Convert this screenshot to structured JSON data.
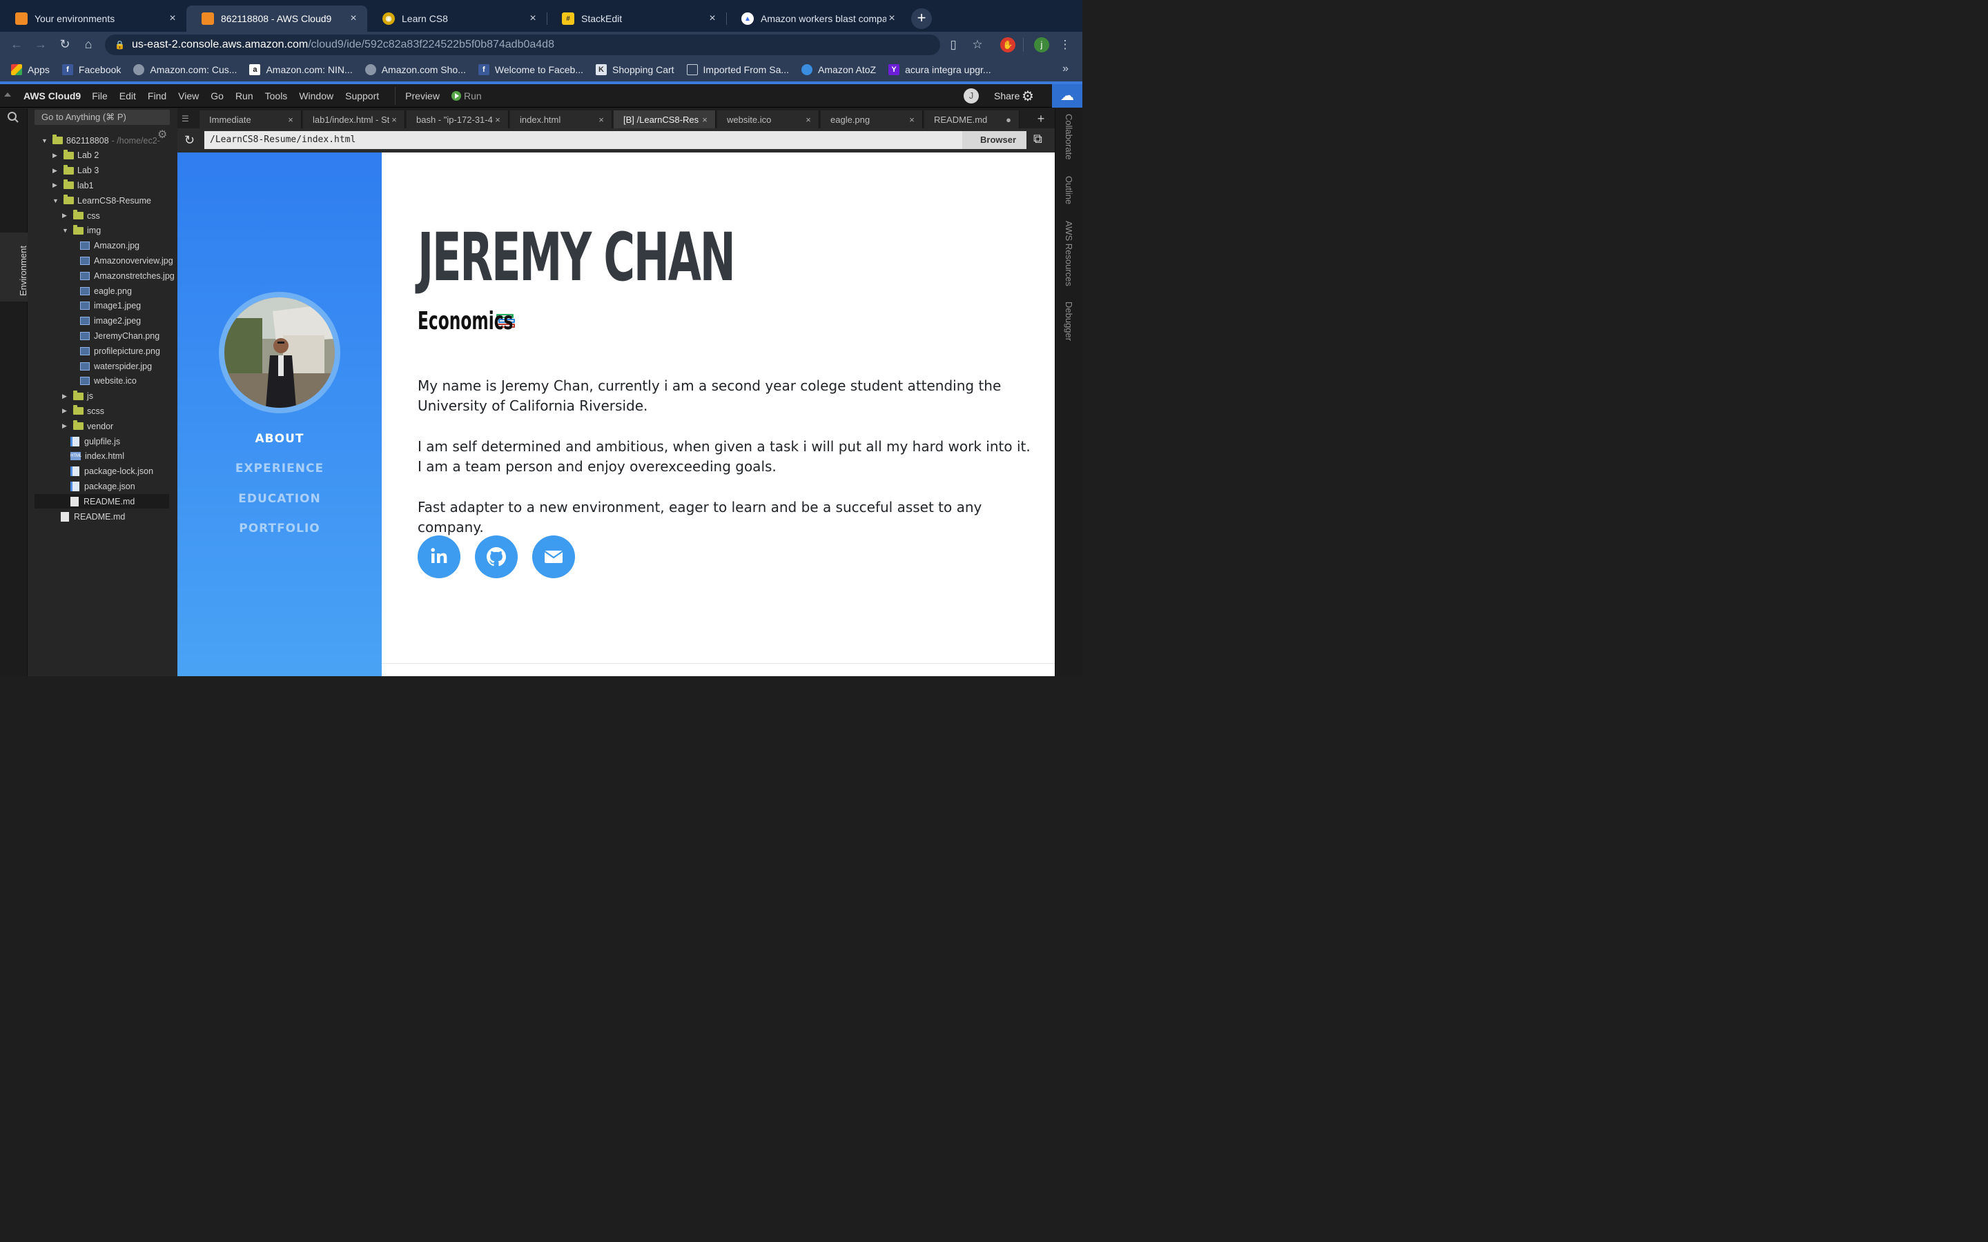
{
  "browser": {
    "tabs": [
      {
        "title": "Your environments",
        "icon": "aws-box-icon",
        "color": "#f08a24",
        "active": false
      },
      {
        "title": "862118808 - AWS Cloud9",
        "icon": "aws-box-icon",
        "color": "#f08a24",
        "active": true
      },
      {
        "title": "Learn CS8",
        "icon": "owl-icon",
        "color": "#d6a800",
        "active": false
      },
      {
        "title": "StackEdit",
        "icon": "stackedit-icon",
        "color": "#f5c518",
        "active": false
      },
      {
        "title": "Amazon workers blast compan",
        "icon": "news-icon",
        "color": "#3b6ee8",
        "active": false
      }
    ],
    "url_host": "us-east-2.console.aws.amazon.com",
    "url_path": "/cloud9/ide/592c82a83f224522b5f0b874adb0a4d8",
    "profile_initial": "j",
    "bookmarks": [
      {
        "label": "Apps",
        "icon": "apps-grid-icon",
        "color": "#e94235"
      },
      {
        "label": "Facebook",
        "icon": "facebook-icon",
        "color": "#3b5998"
      },
      {
        "label": "Amazon.com: Cus...",
        "icon": "globe-icon",
        "color": "#8a96a8"
      },
      {
        "label": "Amazon.com: NIN...",
        "icon": "amazon-icon",
        "color": "#ffffff"
      },
      {
        "label": "Amazon.com Sho...",
        "icon": "globe-icon",
        "color": "#8a96a8"
      },
      {
        "label": "Welcome to Faceb...",
        "icon": "facebook-icon",
        "color": "#3b5998"
      },
      {
        "label": "Shopping Cart",
        "icon": "cart-icon",
        "color": "#6b7a8f"
      },
      {
        "label": "Imported From Sa...",
        "icon": "folder-icon",
        "color": "#9aa7ba"
      },
      {
        "label": "Amazon AtoZ",
        "icon": "atoz-icon",
        "color": "#3b8de0"
      },
      {
        "label": "acura integra upgr...",
        "icon": "yahoo-icon",
        "color": "#6b1fd6"
      }
    ]
  },
  "ide": {
    "app_name": "AWS Cloud9",
    "menu": [
      "File",
      "Edit",
      "Find",
      "View",
      "Go",
      "Run",
      "Tools",
      "Window",
      "Support"
    ],
    "preview_label": "Preview",
    "run_label": "Run",
    "avatar_initial": "J",
    "share_label": "Share",
    "left_panel_tab": "Environment",
    "goto_placeholder": "Go to Anything (⌘ P)",
    "tree": [
      {
        "label": "862118808",
        "suffix": "- /home/ec2-",
        "kind": "folder",
        "depth": 0,
        "open": true
      },
      {
        "label": "Lab 2",
        "kind": "folder",
        "depth": 1,
        "open": false
      },
      {
        "label": "Lab 3",
        "kind": "folder",
        "depth": 1,
        "open": false
      },
      {
        "label": "lab1",
        "kind": "folder",
        "depth": 1,
        "open": false
      },
      {
        "label": "LearnCS8-Resume",
        "kind": "folder",
        "depth": 1,
        "open": true
      },
      {
        "label": "css",
        "kind": "folder",
        "depth": 2,
        "open": false
      },
      {
        "label": "img",
        "kind": "folder",
        "depth": 2,
        "open": true
      },
      {
        "label": "Amazon.jpg",
        "kind": "img",
        "depth": 3
      },
      {
        "label": "Amazonoverview.jpg",
        "kind": "img",
        "depth": 3
      },
      {
        "label": "Amazonstretches.jpg",
        "kind": "img",
        "depth": 3
      },
      {
        "label": "eagle.png",
        "kind": "img",
        "depth": 3
      },
      {
        "label": "image1.jpeg",
        "kind": "img",
        "depth": 3
      },
      {
        "label": "image2.jpeg",
        "kind": "img",
        "depth": 3
      },
      {
        "label": "JeremyChan.png",
        "kind": "img",
        "depth": 3
      },
      {
        "label": "profilepicture.png",
        "kind": "img",
        "depth": 3
      },
      {
        "label": "waterspider.jpg",
        "kind": "img",
        "depth": 3
      },
      {
        "label": "website.ico",
        "kind": "img",
        "depth": 3
      },
      {
        "label": "js",
        "kind": "folder",
        "depth": 2,
        "open": false
      },
      {
        "label": "scss",
        "kind": "folder",
        "depth": 2,
        "open": false
      },
      {
        "label": "vendor",
        "kind": "folder",
        "depth": 2,
        "open": false
      },
      {
        "label": "gulpfile.js",
        "kind": "js",
        "depth": 2
      },
      {
        "label": "index.html",
        "kind": "html",
        "depth": 2
      },
      {
        "label": "package-lock.json",
        "kind": "js",
        "depth": 2
      },
      {
        "label": "package.json",
        "kind": "js",
        "depth": 2
      },
      {
        "label": "README.md",
        "kind": "doc",
        "depth": 2,
        "selected": true
      },
      {
        "label": "README.md",
        "kind": "doc",
        "depth": 1
      }
    ],
    "editor_tabs": [
      {
        "title": "Immediate",
        "active": false,
        "close": "×"
      },
      {
        "title": "lab1/index.html - St",
        "active": false,
        "close": "×"
      },
      {
        "title": "bash - \"ip-172-31-4",
        "active": false,
        "close": "×"
      },
      {
        "title": "index.html",
        "active": false,
        "close": "×"
      },
      {
        "title": "[B] /LearnCS8-Res",
        "active": true,
        "close": "×"
      },
      {
        "title": "website.ico",
        "active": false,
        "close": "×"
      },
      {
        "title": "eagle.png",
        "active": false,
        "close": "×"
      },
      {
        "title": "README.md",
        "active": false,
        "close": "●"
      }
    ],
    "browser_url": "/LearnCS8-Resume/index.html",
    "browser_mode": "Browser",
    "right_tabs": [
      "Collaborate",
      "Outline",
      "AWS Resources",
      "Debugger"
    ]
  },
  "resume": {
    "nav": [
      {
        "label": "ABOUT",
        "active": true
      },
      {
        "label": "EXPERIENCE",
        "active": false
      },
      {
        "label": "EDUCATION",
        "active": false
      },
      {
        "label": "PORTFOLIO",
        "active": false
      }
    ],
    "name": "JEREMY CHAN",
    "subtitle": "Economics",
    "subtitle_emoji": "books-emoji-icon",
    "paragraphs": [
      "My name is Jeremy Chan, currently i am a second year colege student attending the University of California Riverside.",
      "I am self determined and ambitious, when given a task i will put all my hard work into it. I am a team person and enjoy overexceeding goals.",
      "Fast adapter to a new environment, eager to learn and be a succeful asset to any company."
    ],
    "social": [
      "linkedin-icon",
      "github-icon",
      "envelope-icon"
    ],
    "accent_color": "#3d9cf0"
  }
}
